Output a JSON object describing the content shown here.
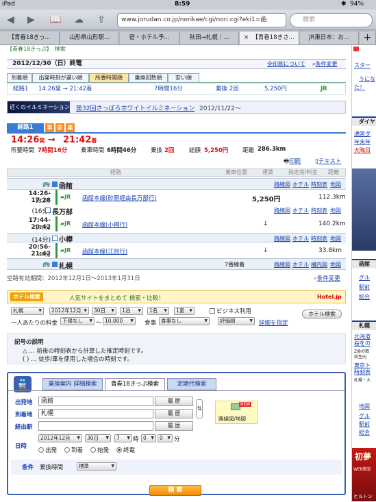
{
  "status": {
    "device": "iPad",
    "time": "8:59",
    "battery": "94%"
  },
  "browser": {
    "url": "www.jorudan.co.jp/norikae/cgi/nori.cgi?eki1=函",
    "search_placeholder": "検索",
    "tabs": [
      "【青春18きっ...",
      "山形県山形駅...",
      "宿・ホテル予...",
      "秋田→札幌｜...",
      "【青春18きさ...",
      "JR東日本：お..."
    ],
    "add_tab": "+",
    "close_tab": "×"
  },
  "page": {
    "top_cut": "【青春18きっぷ】　検索",
    "date": "2012/12/30（日）終電",
    "all_routes_link": "全印刷について",
    "change_condition": "条件変更",
    "sort_tabs": [
      "到着順",
      "出発時刻が遅い順",
      "所要時間順",
      "乗換回数順",
      "安い順"
    ],
    "route_summary": {
      "no": "経路1",
      "time": "14:26発 → 21:42着",
      "duration": "7時間16分",
      "transfer": "乗換 2回",
      "fare": "5,250円",
      "icon": "JR"
    },
    "banner": {
      "img_text": "近くのイルミネーション",
      "title": "第32回さっぽろホワイトイルミネーション",
      "date": "2012/11/22〜"
    },
    "route": {
      "tab": "経路1",
      "badges": [
        "早",
        "安",
        "楽"
      ],
      "dep": "14:26",
      "dep_suffix": "発",
      "arr": "21:42",
      "arr_suffix": "着",
      "stats": {
        "req_label": "所要時間",
        "req": "7時間16分",
        "ride_label": "乗車時間",
        "ride": "6時間46分",
        "tr_label": "乗換",
        "tr": "2回",
        "fare_label": "総額",
        "fare": "5,250円",
        "dist_label": "距離",
        "dist": "286.3km"
      },
      "print": "印刷",
      "text": "テキスト",
      "headers": [
        "経路",
        "乗車位置",
        "運賃",
        "指定席/料金",
        "距離"
      ],
      "station_links": [
        "路線図",
        "ホテル",
        "時刻表",
        "地図"
      ],
      "stations": [
        "函館",
        "長万部",
        "小樽",
        "札幌"
      ],
      "segments": [
        {
          "time": "14:26-17:28",
          "dur": "182分",
          "line": "函館本線(砂原経由長万部行)",
          "fare": "5,250円",
          "km": "112.3km"
        },
        {
          "time": "17:44-20:42",
          "dur": "178分",
          "line": "函館本線(小樽行)",
          "fare": "↓",
          "km": "140.2km"
        },
        {
          "time": "20:56-21:42",
          "dur": "46分",
          "line": "函館本線(江別行)",
          "fare": "↓",
          "km": "33.8km"
        }
      ],
      "waits": [
        "(16分)",
        "(14分)"
      ],
      "sapporo_platform": "7番線着",
      "sapporo_links": [
        "路線図",
        "ホテル",
        "構内図",
        "地図"
      ],
      "validity": "空路有効期間：2012年12月1日〜2013年1月31日",
      "cond_change": "条件変更"
    },
    "hotel": {
      "title": "ホテル検索",
      "catch": "人気サイトをまとめて 検索・比較！",
      "powered": "Hotel.jp",
      "area": "札幌",
      "date": "2012年12月",
      "day": "30日",
      "nights": "1泊",
      "people": "1名",
      "rooms": "1室",
      "biz": "ビジネス利用",
      "price_label": "一人あたりの料金",
      "price_min": "下限なし",
      "price_sep": "〜",
      "price_max": "10,000",
      "meal_label": "食事",
      "meal": "食事なし",
      "sort": "評価順",
      "detail": "詳細を指定",
      "search": "ホテル検索"
    },
    "notes": {
      "title": "記号の説明",
      "l1": "△ … 前後の時刻表から計算した推定時刻です。",
      "l2": "( ) … 徒歩/車を使用した場合の時刻です。"
    },
    "form": {
      "tabs": [
        "乗換案内 詳細検索",
        "青春18きっぷ検索",
        "定期代検索"
      ],
      "from_label": "出発地",
      "from": "函館",
      "to_label": "到着地",
      "to": "札幌",
      "via_label": "経由駅",
      "via": "",
      "history": "履 歴",
      "date_label": "日時",
      "month": "2012年12月",
      "day": "30日",
      "hour": "7",
      "hour_sep": "時",
      "m1": "0",
      "m2": "0",
      "min_suffix": "分",
      "radios": [
        "出発",
        "到着",
        "始発",
        "終電"
      ],
      "cond_label": "条件",
      "transfer_label": "乗換時間",
      "transfer": "標準",
      "map_btn": "路線図/地図",
      "new": "NEW",
      "search": "検 索"
    }
  },
  "sidebar": {
    "items": [
      "スター",
      "うにな",
      "た！",
      "ダイヤ",
      "通常ダ",
      "年末年",
      "大晦日",
      "函館",
      "グル",
      "駅前",
      "総合",
      "札幌",
      "北海道",
      "桜をの",
      "Z会の数",
      "校生向",
      "東京ト",
      "時刻表",
      "札幌・大",
      "地図",
      "グル",
      "駅前",
      "総合",
      "初夢",
      "WEB限定",
      "ヒルトン"
    ]
  }
}
